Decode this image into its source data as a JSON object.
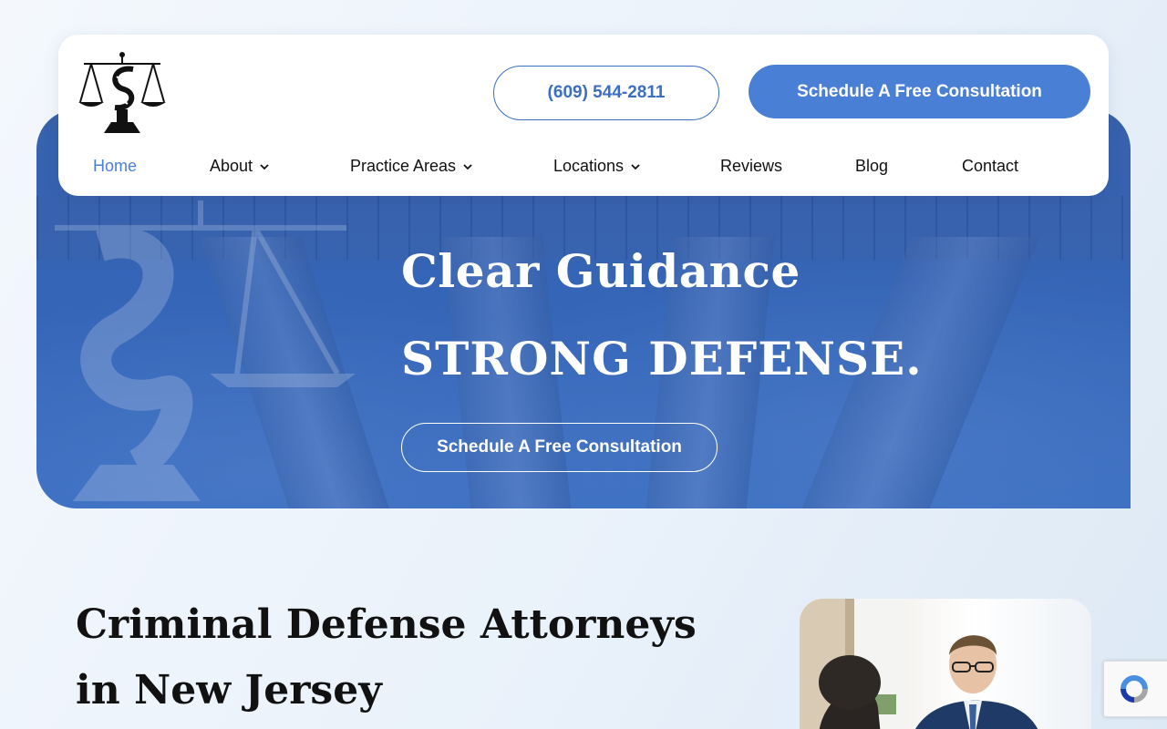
{
  "header": {
    "logo_icon": "scales-of-justice-logo",
    "phone_label": "(609) 544-2811",
    "consult_label": "Schedule A Free Consultation"
  },
  "nav": {
    "items": [
      {
        "label": "Home",
        "dropdown": false,
        "active": true
      },
      {
        "label": "About",
        "dropdown": true,
        "active": false
      },
      {
        "label": "Practice Areas",
        "dropdown": true,
        "active": false
      },
      {
        "label": "Locations",
        "dropdown": true,
        "active": false
      },
      {
        "label": "Reviews",
        "dropdown": false,
        "active": false
      },
      {
        "label": "Blog",
        "dropdown": false,
        "active": false
      },
      {
        "label": "Contact",
        "dropdown": false,
        "active": false
      }
    ]
  },
  "hero": {
    "title_line1": "Clear Guidance",
    "title_line2": "STRONG DEFENSE.",
    "cta_label": "Schedule A Free Consultation"
  },
  "intro": {
    "title": "Criminal Defense Attorneys in New Jersey"
  },
  "colors": {
    "accent": "#4a7fd6",
    "hero_blue": "#3a68b8",
    "text_dark": "#111111"
  },
  "widgets": {
    "recaptcha_icon": "recaptcha-icon"
  }
}
